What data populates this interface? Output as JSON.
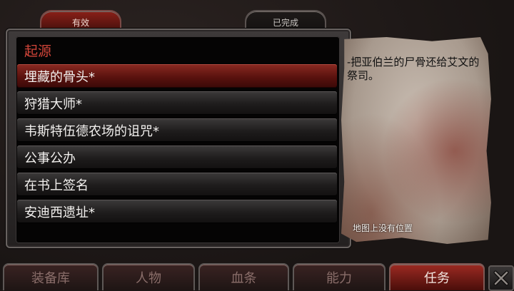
{
  "top_tabs": {
    "active": "有效",
    "completed": "已完成"
  },
  "quest_list": {
    "heading": "起源",
    "items": [
      {
        "label": "埋藏的骨头*",
        "selected": true
      },
      {
        "label": "狩猎大师*",
        "selected": false
      },
      {
        "label": "韦斯特伍德农场的诅咒*",
        "selected": false
      },
      {
        "label": "公事公办",
        "selected": false
      },
      {
        "label": "在书上签名",
        "selected": false
      },
      {
        "label": "安迪西遗址*",
        "selected": false
      }
    ]
  },
  "detail": {
    "description": "-把亚伯兰的尸骨还给艾文的祭司。",
    "map_note": "地图上没有位置"
  },
  "bottom_nav": {
    "equipment": "装备库",
    "character": "人物",
    "blood": "血条",
    "abilities": "能力",
    "quests": "任务",
    "active": "quests"
  },
  "colors": {
    "accent_red": "#8a2a22",
    "heading_red": "#d4463a",
    "parchment": "#b8aa9e"
  },
  "icons": {
    "close": "close-x-icon"
  }
}
